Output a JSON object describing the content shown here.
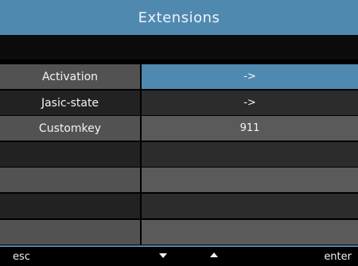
{
  "title": "Extensions",
  "rows": [
    {
      "label": "Activation",
      "value": "->",
      "selected": true
    },
    {
      "label": "Jasic-state",
      "value": "->",
      "selected": false
    },
    {
      "label": "Customkey",
      "value": "911",
      "selected": false
    }
  ],
  "footer": {
    "esc_label": "esc",
    "down_icon": "triangle-down-icon",
    "up_icon": "triangle-up-icon",
    "enter_label": "enter"
  },
  "colors": {
    "accent": "#5089b0",
    "row_gray": "#525252",
    "row_dark": "#222222"
  }
}
